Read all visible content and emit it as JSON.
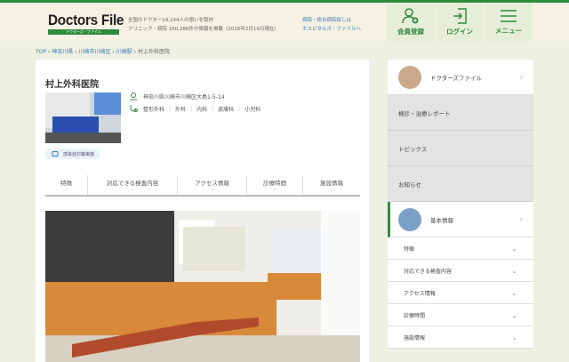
{
  "header": {
    "logo": "Doctors File",
    "logo_sub": "ドクターズ・ファイル",
    "tagline_1": "全国のドクター14,144人の想いを取材",
    "tagline_2": "クリニック・病院 160,286件の情報を掲載（2026年2月19日現在）",
    "hospitals_link_1": "病院・総合病院探しは",
    "hospitals_link_2": "ホスピタルズ・ファイルへ",
    "buttons": [
      {
        "label": "会員登録",
        "icon": "user-plus-icon"
      },
      {
        "label": "ログイン",
        "icon": "login-icon"
      },
      {
        "label": "メニュー",
        "icon": "menu-icon"
      }
    ]
  },
  "breadcrumb": [
    "TOP",
    "神奈川県",
    "川崎市川崎区",
    "川崎駅",
    "村上外科医院"
  ],
  "clinic": {
    "name": "村上外科医院",
    "address": "神奈川県川崎市川崎区大島1-5-14",
    "departments": [
      "整形外科",
      "外科",
      "内科",
      "皮膚科",
      "小児科"
    ],
    "badge": "感染症対策実施"
  },
  "tabs": [
    "特徴",
    "対応できる検査内容",
    "アクセス情報",
    "診療時間",
    "施設情報"
  ],
  "sidebar": {
    "doctors_file": "ドクターズファイル",
    "gray_items": [
      "検診・治療レポート",
      "トピックス",
      "お知らせ"
    ],
    "basic_info": "基本情報",
    "sub_items": [
      "特徴",
      "対応できる検査内容",
      "アクセス情報",
      "診療時間",
      "施設情報"
    ]
  },
  "colors": {
    "brand": "#2e8b3e",
    "link": "#3a7ab8"
  }
}
